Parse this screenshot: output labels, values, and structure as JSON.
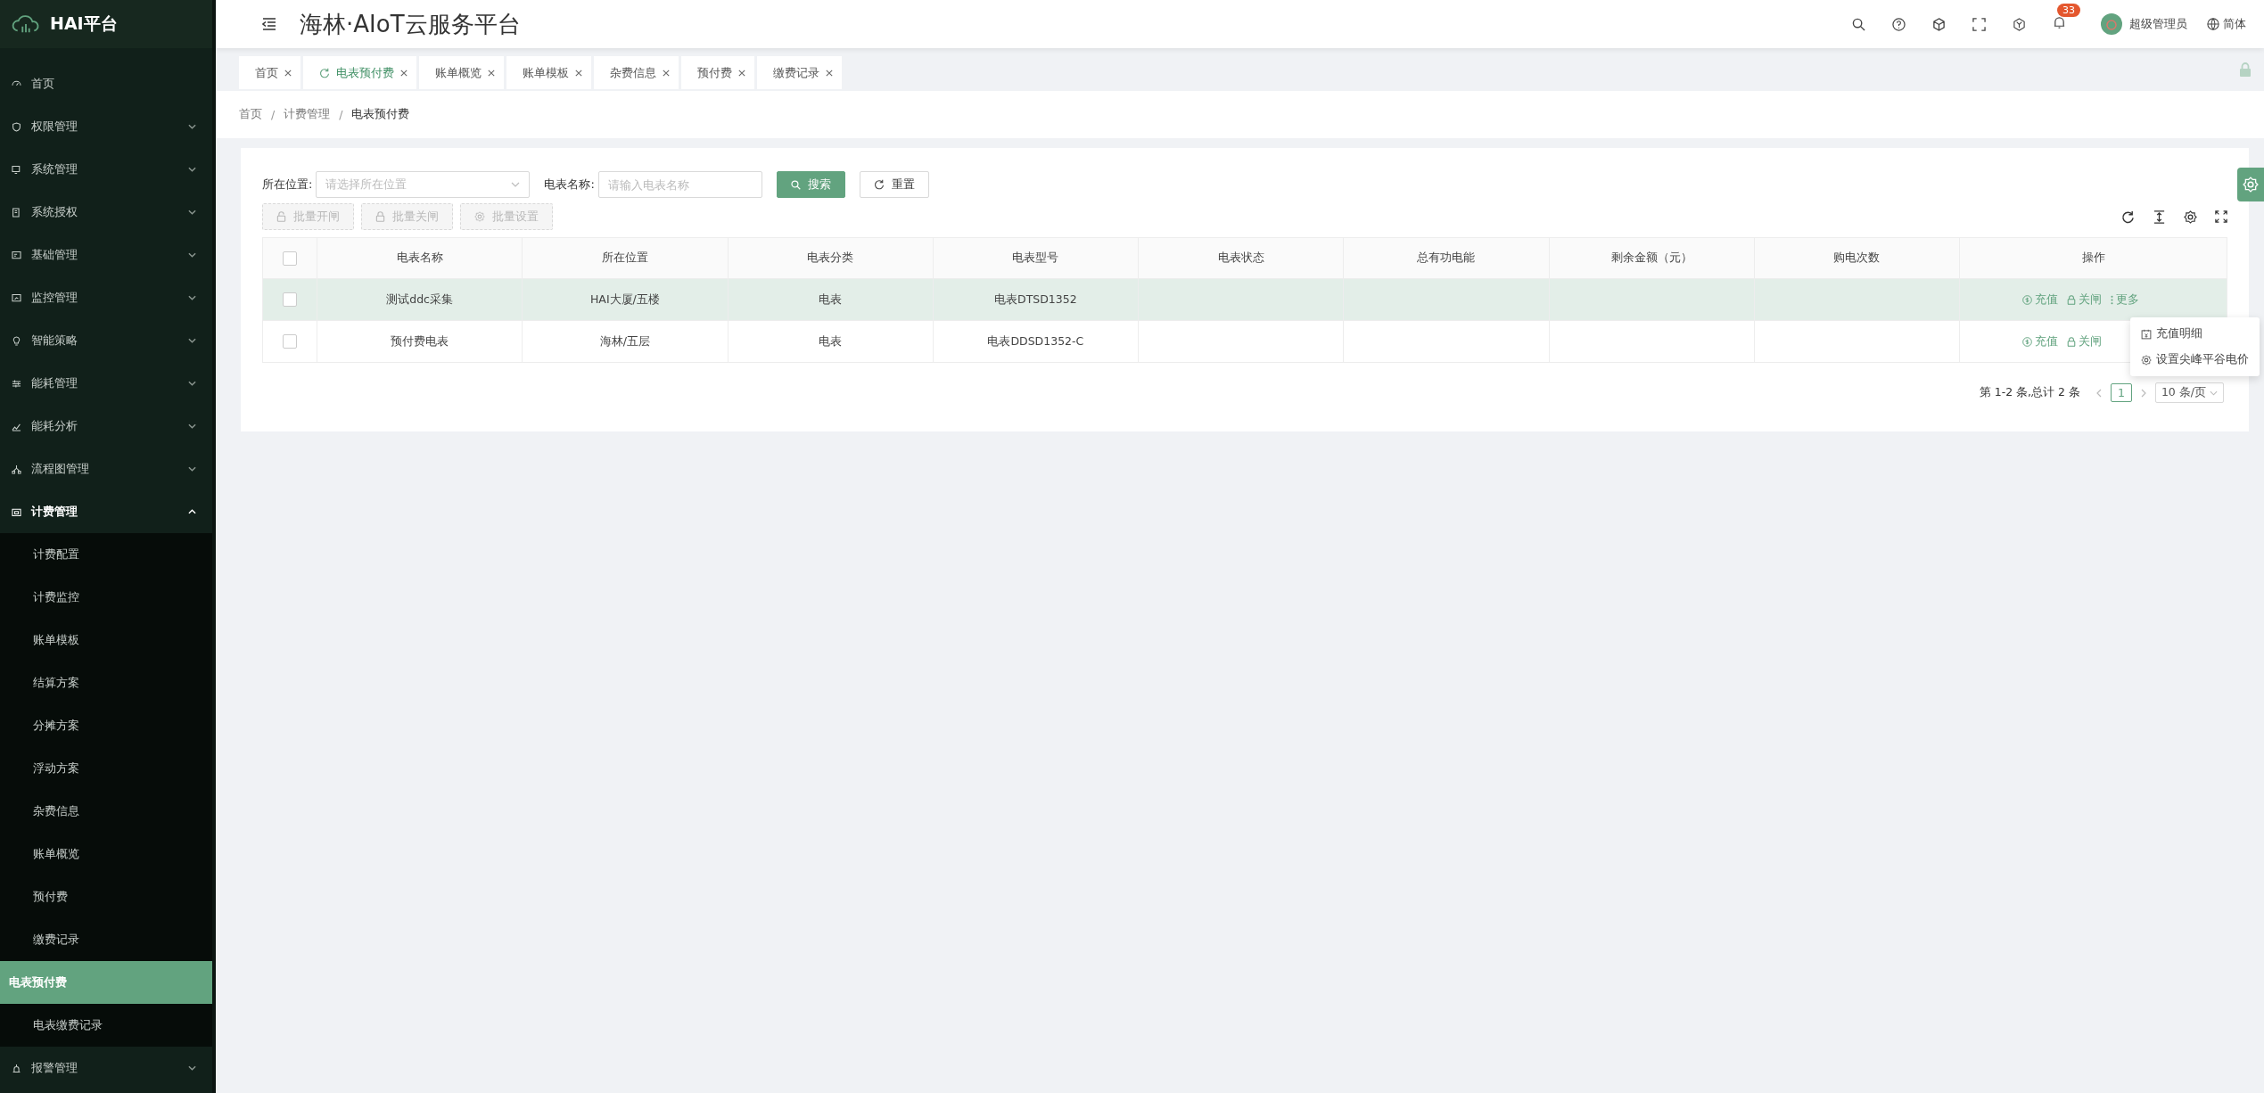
{
  "sidebar": {
    "title": "HAI平台",
    "items": [
      {
        "label": "首页",
        "kind": "link",
        "selected": false
      },
      {
        "label": "权限管理",
        "kind": "group",
        "expanded": false
      },
      {
        "label": "系统管理",
        "kind": "group",
        "expanded": false
      },
      {
        "label": "系统授权",
        "kind": "group",
        "expanded": false
      },
      {
        "label": "基础管理",
        "kind": "group",
        "expanded": false
      },
      {
        "label": "监控管理",
        "kind": "group",
        "expanded": false
      },
      {
        "label": "智能策略",
        "kind": "group",
        "expanded": false
      },
      {
        "label": "能耗管理",
        "kind": "group",
        "expanded": false
      },
      {
        "label": "能耗分析",
        "kind": "group",
        "expanded": false
      },
      {
        "label": "流程图管理",
        "kind": "group",
        "expanded": false
      },
      {
        "label": "计费管理",
        "kind": "group",
        "expanded": true,
        "children": [
          {
            "label": "计费配置",
            "selected": false
          },
          {
            "label": "计费监控",
            "selected": false
          },
          {
            "label": "账单模板",
            "selected": false
          },
          {
            "label": "结算方案",
            "selected": false
          },
          {
            "label": "分摊方案",
            "selected": false
          },
          {
            "label": "浮动方案",
            "selected": false
          },
          {
            "label": "杂费信息",
            "selected": false
          },
          {
            "label": "账单概览",
            "selected": false
          },
          {
            "label": "预付费",
            "selected": false
          },
          {
            "label": "缴费记录",
            "selected": false
          },
          {
            "label": "电表预付费",
            "selected": true
          },
          {
            "label": "电表缴费记录",
            "selected": false
          }
        ]
      },
      {
        "label": "报警管理",
        "kind": "group",
        "expanded": false
      }
    ]
  },
  "header": {
    "title": "海林·AIoT云服务平台",
    "notification_count": "33",
    "user": "超级管理员",
    "language": "简体"
  },
  "tabs": [
    {
      "label": "首页",
      "selected": false,
      "loading": false
    },
    {
      "label": "电表预付费",
      "selected": true,
      "loading": true
    },
    {
      "label": "账单概览",
      "selected": false,
      "loading": false
    },
    {
      "label": "账单模板",
      "selected": false,
      "loading": false
    },
    {
      "label": "杂费信息",
      "selected": false,
      "loading": false
    },
    {
      "label": "预付费",
      "selected": false,
      "loading": false
    },
    {
      "label": "缴费记录",
      "selected": false,
      "loading": false
    }
  ],
  "breadcrumb": [
    {
      "label": "首页"
    },
    {
      "separator": "/",
      "label": "计费管理"
    },
    {
      "separator": "/",
      "label": "电表预付费"
    }
  ],
  "filters": [
    {
      "kind": "select",
      "label": "所在位置:",
      "placeholder": "请选择所在位置"
    },
    {
      "kind": "input",
      "label": "电表名称:",
      "placeholder": "请输入电表名称"
    }
  ],
  "search_button": "搜索",
  "reset_button": "重置",
  "batch_buttons": [
    {
      "label": "批量开闸",
      "kind": "unlock",
      "disabled": true
    },
    {
      "label": "批量关闸",
      "kind": "lock",
      "disabled": true
    },
    {
      "label": "批量设置",
      "kind": "settings",
      "disabled": true
    }
  ],
  "table": {
    "select_all_checked": false,
    "columns": [
      "电表名称",
      "所在位置",
      "电表分类",
      "电表型号",
      "电表状态",
      "总有功电能",
      "剩余金额（元）",
      "购电次数",
      "操作"
    ],
    "rows": [
      {
        "highlighted": true,
        "checked": false,
        "cells": [
          "测试ddc采集",
          "HAI大厦/五楼",
          "电表",
          "电表DTSD1352"
        ],
        "actions": [
          {
            "kind": "recharge",
            "label": "充值"
          },
          {
            "kind": "close",
            "label": "关闸"
          },
          {
            "kind": "more",
            "label": "更多"
          }
        ]
      },
      {
        "highlighted": false,
        "checked": false,
        "cells": [
          "预付费电表",
          "海林/五层",
          "电表",
          "电表DDSD1352-C"
        ],
        "actions": [
          {
            "kind": "recharge",
            "label": "充值"
          },
          {
            "kind": "close",
            "label": "关闸"
          }
        ]
      }
    ]
  },
  "more_menu": [
    {
      "kind": "detail",
      "label": "充值明细"
    },
    {
      "kind": "settings",
      "label": "设置尖峰平谷电价"
    }
  ],
  "pagination": {
    "summary": "第 1-2 条,总计 2 条",
    "pages": [
      {
        "label": "1",
        "selected": true
      }
    ],
    "page_size": "10 条/页"
  }
}
